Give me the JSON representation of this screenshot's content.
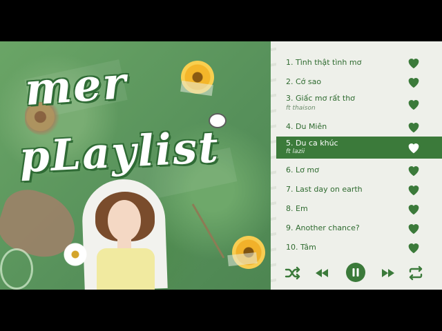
{
  "playlist": {
    "title_line1": "mer",
    "title_line2": "pLaylist",
    "tracks": [
      {
        "number": "1.",
        "title": "Tình thật tình mơ",
        "feat": "",
        "liked": true,
        "active": false
      },
      {
        "number": "2.",
        "title": "Cớ sao",
        "feat": "",
        "liked": true,
        "active": false
      },
      {
        "number": "3.",
        "title": "Giấc mơ rất thơ",
        "feat": "ft thaison",
        "liked": true,
        "active": false
      },
      {
        "number": "4.",
        "title": "Du Miên",
        "feat": "",
        "liked": true,
        "active": false
      },
      {
        "number": "5.",
        "title": "Du ca khúc",
        "feat": "ft lazii",
        "liked": true,
        "active": true
      },
      {
        "number": "6.",
        "title": "Lơ mơ",
        "feat": "",
        "liked": true,
        "active": false
      },
      {
        "number": "7.",
        "title": "Last day on earth",
        "feat": "",
        "liked": true,
        "active": false
      },
      {
        "number": "8.",
        "title": "Em",
        "feat": "",
        "liked": true,
        "active": false
      },
      {
        "number": "9.",
        "title": "Another chance?",
        "feat": "",
        "liked": true,
        "active": false
      },
      {
        "number": "10.",
        "title": "Tâm",
        "feat": "",
        "liked": true,
        "active": false
      }
    ]
  },
  "controls": {
    "shuffle": "shuffle-icon",
    "previous": "previous-icon",
    "play_pause": "pause-icon",
    "next": "next-icon",
    "repeat": "repeat-icon"
  },
  "colors": {
    "accent": "#3b7a3a",
    "panel": "#eef0ea",
    "heart": "#3b7a3a"
  }
}
